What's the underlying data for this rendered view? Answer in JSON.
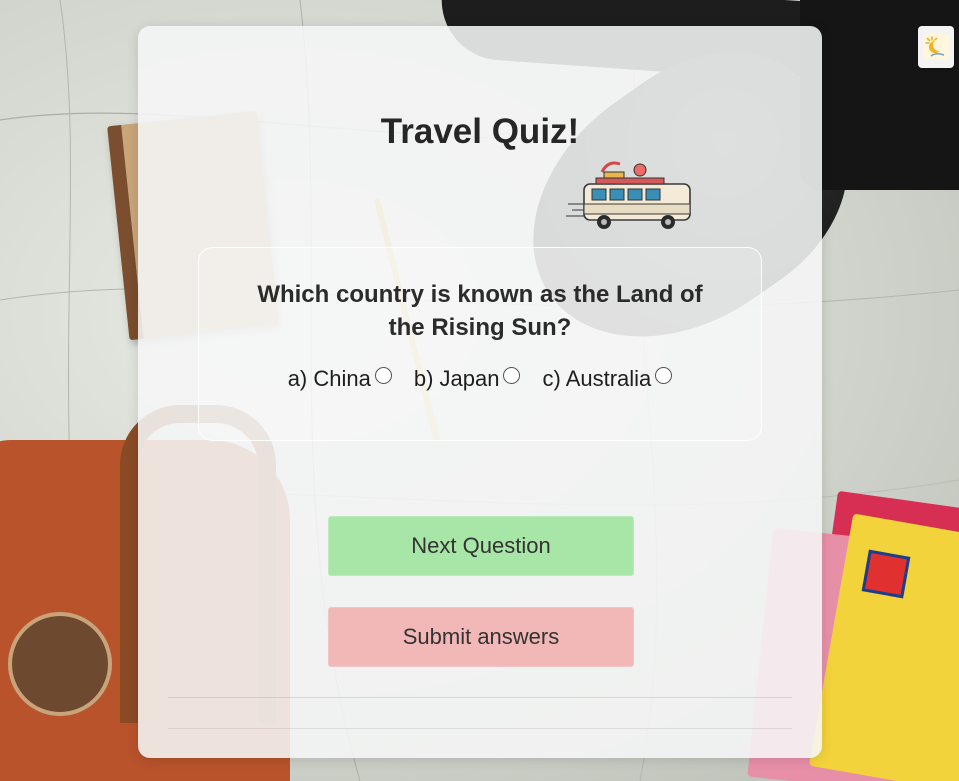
{
  "quiz": {
    "title": "Travel Quiz!",
    "question": "Which country is known as the Land of the Rising Sun?",
    "options": [
      {
        "label": "a) China"
      },
      {
        "label": "b) Japan"
      },
      {
        "label": "c) Australia"
      }
    ]
  },
  "buttons": {
    "next_label": "Next Question",
    "submit_label": "Submit answers"
  },
  "icons": {
    "theme_toggle": "sun-moon-icon",
    "mascot": "camper-van-icon"
  },
  "colors": {
    "next_button": "#a8e6a8",
    "submit_button": "#f2b7b7",
    "title_text": "#262626"
  }
}
